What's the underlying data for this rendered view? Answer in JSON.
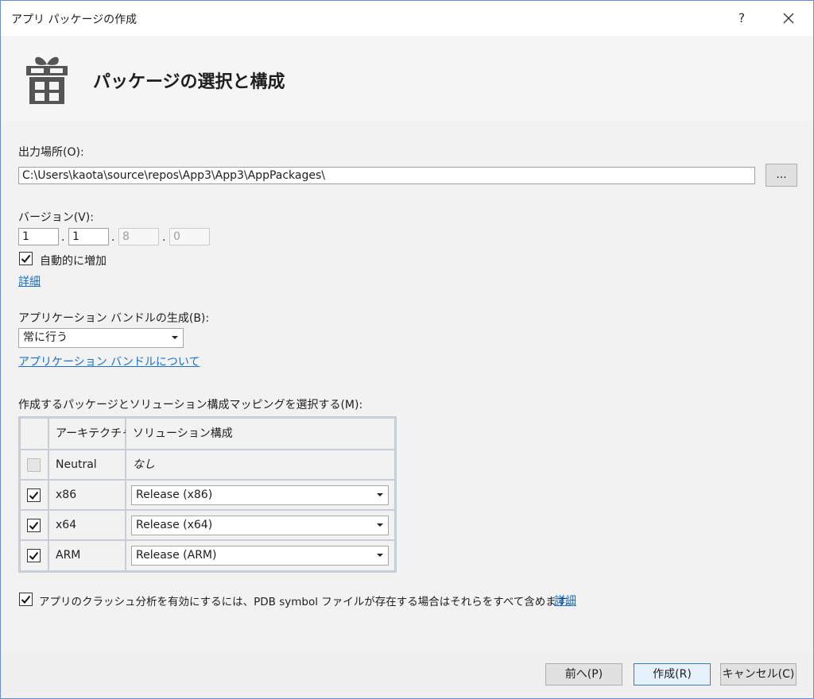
{
  "window": {
    "title": "アプリ パッケージの作成",
    "help_label": "?"
  },
  "header": {
    "heading": "パッケージの選択と構成",
    "icon": "gift-icon"
  },
  "output": {
    "label": "出力場所(O):",
    "path": "C:\\Users\\kaota\\source\\repos\\App3\\App3\\AppPackages\\",
    "browse_label": "..."
  },
  "version": {
    "label": "バージョン(V):",
    "parts": [
      "1",
      "1",
      "8",
      "0"
    ],
    "separator": ".",
    "auto_increment_label": "自動的に増加",
    "auto_increment_checked": true,
    "details_link": "詳細"
  },
  "bundle": {
    "label": "アプリケーション バンドルの生成(B):",
    "selected": "常に行う",
    "about_link": "アプリケーション バンドルについて"
  },
  "mapping": {
    "label": "作成するパッケージとソリューション構成マッピングを選択する(M):",
    "columns": [
      "アーキテクチャ",
      "ソリューション構成"
    ],
    "rows": [
      {
        "checked": false,
        "disabled": true,
        "arch": "Neutral",
        "config": "なし",
        "combo": false
      },
      {
        "checked": true,
        "disabled": false,
        "arch": "x86",
        "config": "Release (x86)",
        "combo": true
      },
      {
        "checked": true,
        "disabled": false,
        "arch": "x64",
        "config": "Release (x64)",
        "combo": true
      },
      {
        "checked": true,
        "disabled": false,
        "arch": "ARM",
        "config": "Release (ARM)",
        "combo": true
      }
    ]
  },
  "crash": {
    "label": "アプリのクラッシュ分析を有効にするには、PDB symbol ファイルが存在する場合はそれらをすべて含めます。",
    "checked": true,
    "details_link": "詳細"
  },
  "footer": {
    "back_label": "前へ(P)",
    "create_label": "作成(R)",
    "cancel_label": "キャンセル(C)"
  },
  "colors": {
    "accent": "#1a6fc9",
    "border": "#6a8bd8"
  }
}
